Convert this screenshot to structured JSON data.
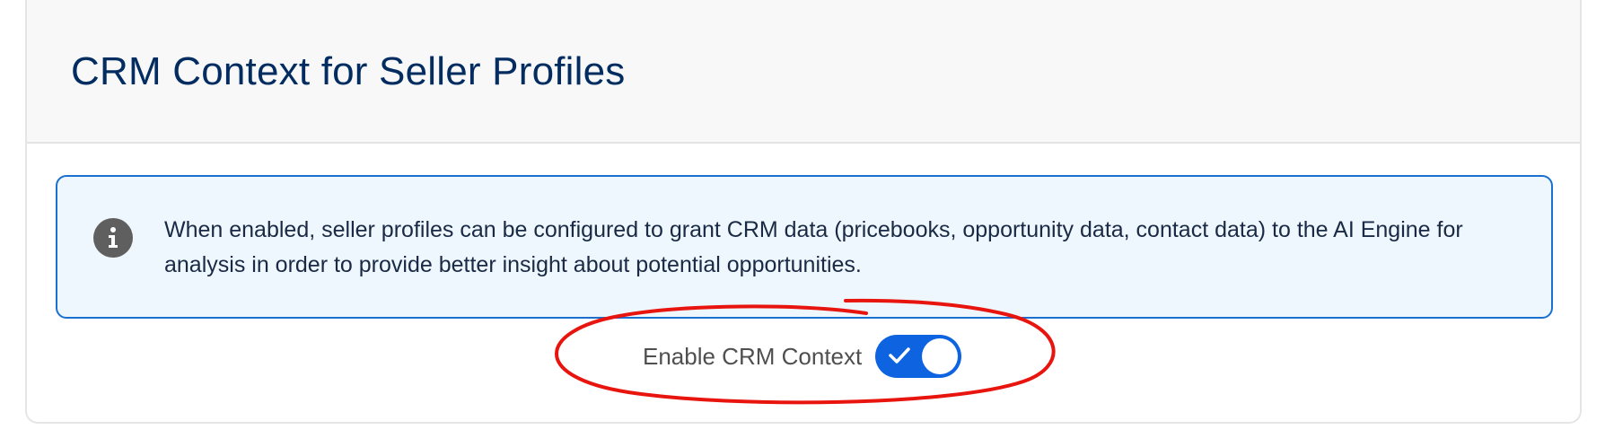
{
  "card": {
    "title": "CRM Context for Seller Profiles"
  },
  "info": {
    "icon": "info-icon",
    "text": "When enabled, seller profiles can be configured to grant CRM data (pricebooks, opportunity data, contact data) to the AI Engine for analysis in order to provide better insight about potential opportunities."
  },
  "toggle": {
    "label": "Enable CRM Context",
    "checked": true,
    "icon": "checkmark-icon"
  },
  "colors": {
    "title": "#032d60",
    "accent": "#0d63e0",
    "info_border": "#1b6fcf",
    "info_background": "#eef6fe",
    "annotation": "#e8150f"
  }
}
